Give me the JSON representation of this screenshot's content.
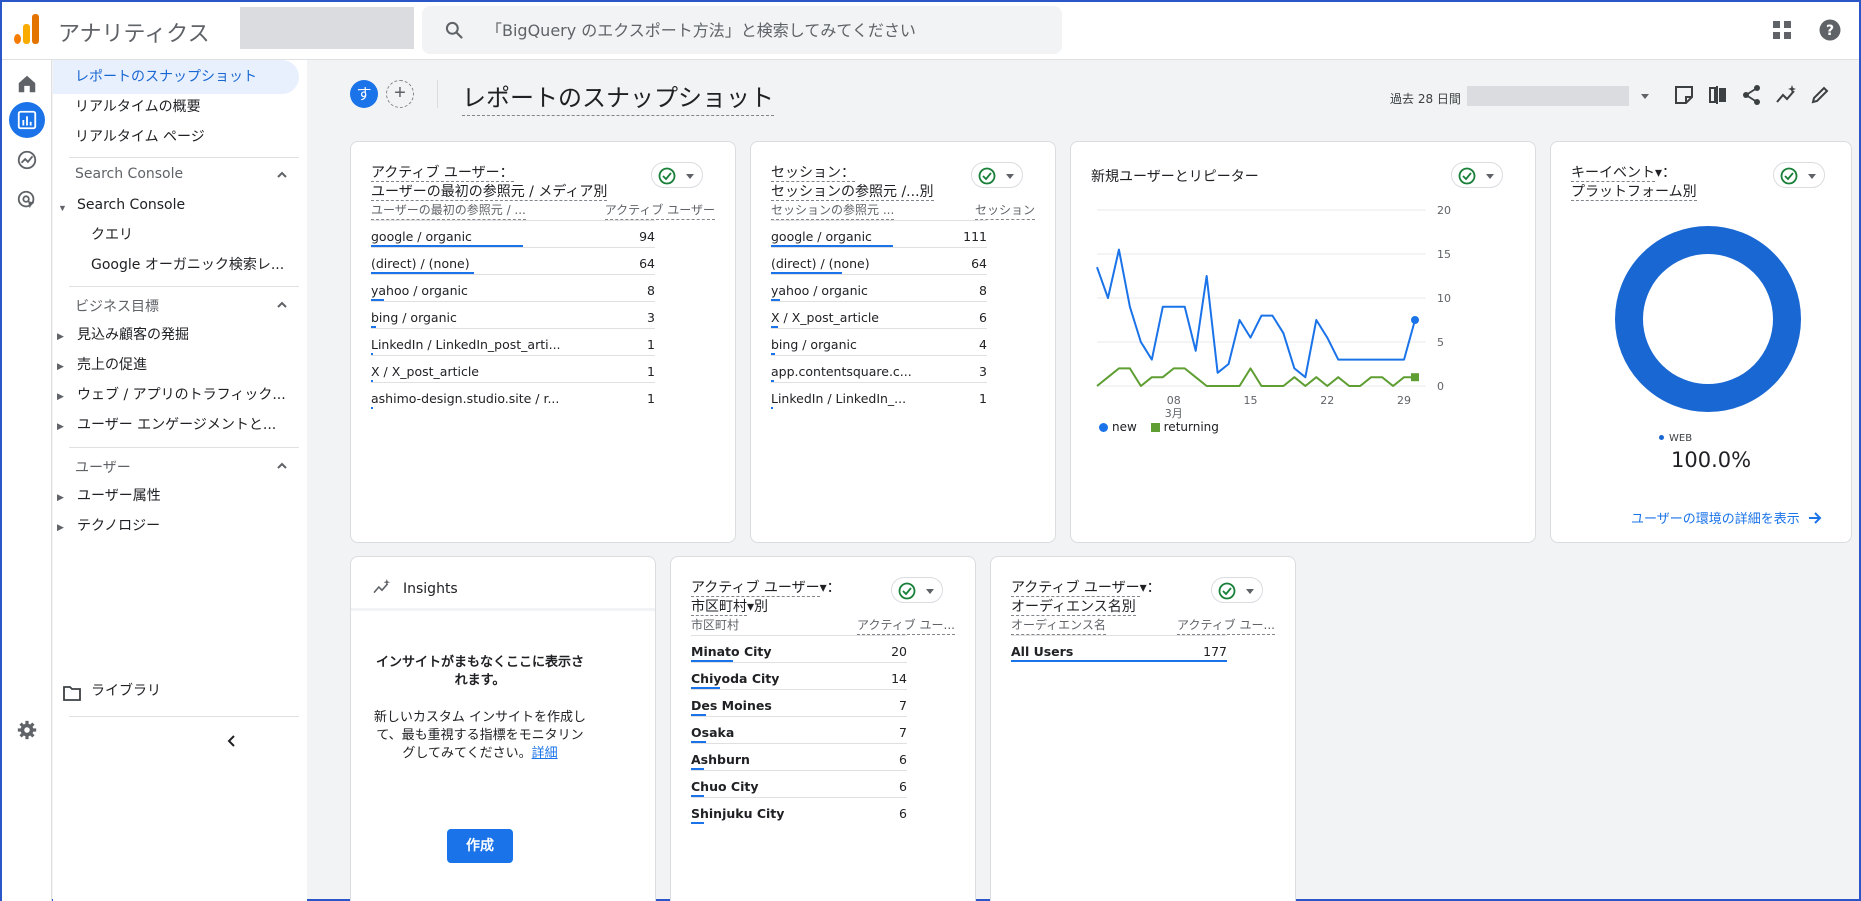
{
  "topbar": {
    "app_title": "アナリティクス",
    "search_placeholder": "「BigQuery のエクスポート方法」と検索してみてください"
  },
  "sidenav": {
    "items": [
      {
        "label": "レポートのスナップショット"
      },
      {
        "label": "リアルタイムの概要"
      },
      {
        "label": "リアルタイム ページ"
      }
    ],
    "search_console_section": "Search Console",
    "search_console_group": "Search Console",
    "search_console_children": [
      "クエリ",
      "Google オーガニック検索レ..."
    ],
    "business_section": "ビジネス目標",
    "business_items": [
      "見込み顧客の発掘",
      "売上の促進",
      "ウェブ / アプリのトラフィック...",
      "ユーザー エンゲージメントと..."
    ],
    "user_section": "ユーザー",
    "user_items": [
      "ユーザー属性",
      "テクノロジー"
    ],
    "library": "ライブラリ"
  },
  "header": {
    "avatar_letter": "す",
    "add_symbol": "+",
    "page_title": "レポートのスナップショット",
    "date_label": "過去 28 日間"
  },
  "card1": {
    "title_line1": "アクティブ ユーザー：",
    "title_line2": "ユーザーの最初の参照元 / メディア別",
    "col_left": "ユーザーの最初の参照元 / ...",
    "col_right": "アクティブ ユーザー",
    "rows": [
      {
        "label": "google / organic",
        "value": "94",
        "ratio": 1.0
      },
      {
        "label": "(direct) / (none)",
        "value": "64",
        "ratio": 0.68
      },
      {
        "label": "yahoo / organic",
        "value": "8",
        "ratio": 0.085
      },
      {
        "label": "bing / organic",
        "value": "3",
        "ratio": 0.032
      },
      {
        "label": "LinkedIn / LinkedIn_post_arti...",
        "value": "1",
        "ratio": 0.011
      },
      {
        "label": "X / X_post_article",
        "value": "1",
        "ratio": 0.011
      },
      {
        "label": "ashimo-design.studio.site / r...",
        "value": "1",
        "ratio": 0.011
      }
    ]
  },
  "card2": {
    "title_line1": "セッション：",
    "title_line2": "セッションの参照元 /...別",
    "col_left": "セッションの参照元 ...",
    "col_right": "セッション",
    "rows": [
      {
        "label": "google / organic",
        "value": "111",
        "ratio": 1.0
      },
      {
        "label": "(direct) / (none)",
        "value": "64",
        "ratio": 0.58
      },
      {
        "label": "yahoo / organic",
        "value": "8",
        "ratio": 0.072
      },
      {
        "label": "X / X_post_article",
        "value": "6",
        "ratio": 0.054
      },
      {
        "label": "bing / organic",
        "value": "4",
        "ratio": 0.036
      },
      {
        "label": "app.contentsquare.c...",
        "value": "3",
        "ratio": 0.027
      },
      {
        "label": "LinkedIn / LinkedIn_...",
        "value": "1",
        "ratio": 0.009
      }
    ]
  },
  "chart_data": {
    "type": "line",
    "title": "新規ユーザーとリピーター",
    "ylim": [
      0,
      20
    ],
    "y_ticks": [
      "0",
      "5",
      "10",
      "15",
      "20"
    ],
    "x_tick_labels": [
      {
        "label": "08",
        "sublabel": "3月",
        "index": 7
      },
      {
        "label": "15",
        "index": 14
      },
      {
        "label": "22",
        "index": 21
      },
      {
        "label": "29",
        "index": 28
      }
    ],
    "series": [
      {
        "name": "new",
        "color": "#1a73e8",
        "values": [
          13.5,
          10,
          15.5,
          9,
          5,
          3,
          9,
          9,
          9,
          4,
          12.5,
          1.5,
          2.5,
          7.5,
          5.5,
          8,
          8,
          6,
          2,
          1,
          7.5,
          5.5,
          3,
          3,
          3,
          3,
          3,
          3,
          3,
          7.5
        ]
      },
      {
        "name": "returning",
        "color": "#5e9e32",
        "values": [
          0,
          1,
          2,
          2,
          0,
          1,
          1,
          2,
          2,
          1,
          0,
          0,
          0,
          0,
          2,
          0,
          0,
          0,
          1,
          0,
          1,
          0,
          1,
          0,
          0,
          1,
          1,
          0,
          1,
          1
        ]
      }
    ]
  },
  "card4": {
    "title_line1": "キーイベント",
    "title_suffix": "：",
    "title_line2": "プラットフォーム別",
    "legend_label": "WEB",
    "legend_value": "100.0%",
    "link": "ユーザーの環境の詳細を表示",
    "donut_fraction": 1.0
  },
  "insights": {
    "title": "Insights",
    "headline": "インサイトがまもなくここに表示されます。",
    "body": "新しいカスタム インサイトを作成して、最も重視する指標をモニタリングしてみてください。",
    "link": "詳細",
    "button": "作成"
  },
  "card6": {
    "title_line1": "アクティブ ユーザー",
    "title_suffix": "：",
    "title_line2": "市区町村",
    "title_line2_suffix": "別",
    "col_left": "市区町村",
    "col_right": "アクティブ ユー...",
    "rows": [
      {
        "label": "Minato City",
        "value": "20",
        "ratio": 1.0
      },
      {
        "label": "Chiyoda City",
        "value": "14",
        "ratio": 0.7
      },
      {
        "label": "Des Moines",
        "value": "7",
        "ratio": 0.35
      },
      {
        "label": "Osaka",
        "value": "7",
        "ratio": 0.35
      },
      {
        "label": "Ashburn",
        "value": "6",
        "ratio": 0.3
      },
      {
        "label": "Chuo City",
        "value": "6",
        "ratio": 0.3
      },
      {
        "label": "Shinjuku City",
        "value": "6",
        "ratio": 0.3
      }
    ]
  },
  "card7": {
    "title_line1": "アクティブ ユーザー",
    "title_suffix": "：",
    "title_line2": "オーディエンス名別",
    "col_left": "オーディエンス名",
    "col_right": "アクティブ ユー...",
    "rows": [
      {
        "label": "All Users",
        "value": "177",
        "ratio": 1.0
      }
    ]
  }
}
